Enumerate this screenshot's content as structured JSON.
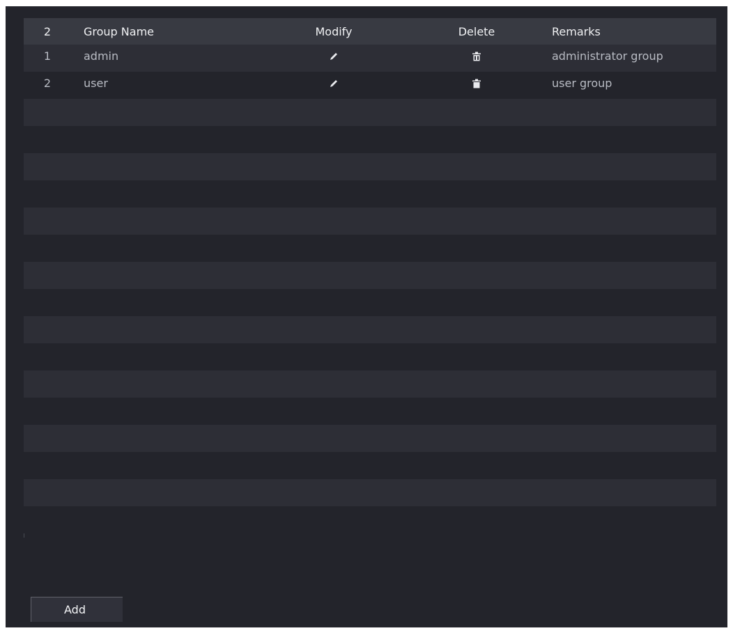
{
  "table": {
    "headers": {
      "index": "2",
      "group_name": "Group Name",
      "modify": "Modify",
      "delete": "Delete",
      "remarks": "Remarks"
    },
    "rows": [
      {
        "index": "1",
        "group_name": "admin",
        "remarks": "administrator group",
        "modify_icon": "pencil-icon",
        "delete_icon": "trash-icon"
      },
      {
        "index": "2",
        "group_name": "user",
        "remarks": "user group",
        "modify_icon": "pencil-icon",
        "delete_icon": "trash-icon"
      }
    ]
  },
  "actions": {
    "add_label": "Add"
  },
  "colors": {
    "background": "#23242b",
    "header_row": "#383a42",
    "striped_row": "#2d2e36",
    "text": "#b9bcc4"
  }
}
